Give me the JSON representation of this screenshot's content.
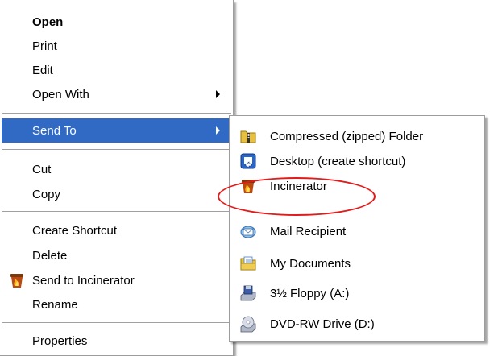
{
  "context_menu": {
    "items": [
      {
        "label": "Open"
      },
      {
        "label": "Print"
      },
      {
        "label": "Edit"
      },
      {
        "label": "Open With"
      },
      {
        "label": "Send To"
      },
      {
        "label": "Cut"
      },
      {
        "label": "Copy"
      },
      {
        "label": "Create Shortcut"
      },
      {
        "label": "Delete"
      },
      {
        "label": "Send to Incinerator"
      },
      {
        "label": "Rename"
      },
      {
        "label": "Properties"
      }
    ],
    "selected_item": "Send To"
  },
  "send_to_submenu": {
    "items": [
      {
        "label": "Compressed (zipped) Folder",
        "icon": "zip-folder-icon"
      },
      {
        "label": "Desktop (create shortcut)",
        "icon": "desktop-shortcut-icon"
      },
      {
        "label": "Incinerator",
        "icon": "incinerator-icon"
      },
      {
        "label": "Mail Recipient",
        "icon": "mail-icon"
      },
      {
        "label": "My Documents",
        "icon": "documents-folder-icon"
      },
      {
        "label": "3½ Floppy (A:)",
        "icon": "floppy-drive-icon"
      },
      {
        "label": "DVD-RW Drive (D:)",
        "icon": "dvd-drive-icon"
      }
    ],
    "highlighted_item": "Incinerator"
  },
  "colors": {
    "selection": "#316ac5",
    "highlight_ring": "#e21b1b",
    "menu_border": "#9d9d9d"
  }
}
